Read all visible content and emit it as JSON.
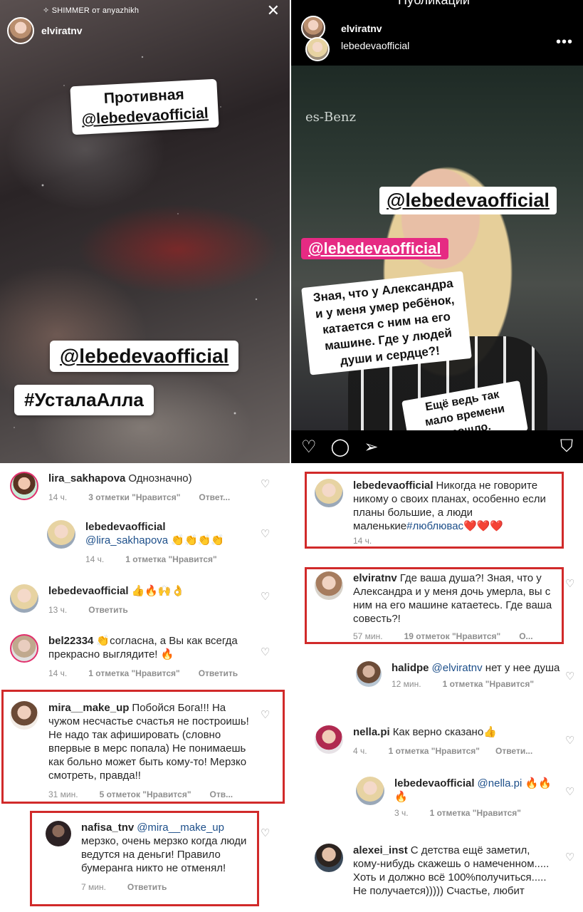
{
  "story_left": {
    "top_text": "SHIMMER от anyazhikh",
    "username": "elviratnv",
    "sticker1_line1": "Противная",
    "sticker1_line2": "@lebedevaofficial",
    "sticker2": "@lebedevaofficial",
    "sticker3": "#УсталаАлла"
  },
  "story_right": {
    "top_label": "Публикации",
    "username1": "elviratnv",
    "username2": "lebedevaofficial",
    "photo_brand": "es-Benz",
    "tag_white": "@lebedevaofficial",
    "tag_pink": "@lebedevaofficial",
    "caption": "Зная, что у Александра и у меня умер ребёнок, катается с ним на его машине. Где у людей души и сердце?!",
    "caption2": "Ещё ведь так мало времени прошло."
  },
  "comments_left": [
    {
      "user": "lira_sakhapova",
      "text": "Однозначно)",
      "time": "14 ч.",
      "likes": "3 отметки \"Нравится\"",
      "reply": "Ответ..."
    },
    {
      "user": "lebedevaofficial",
      "mention": "@lira_sakhapova",
      "text": "👏👏👏👏",
      "time": "14 ч.",
      "likes": "1 отметка \"Нравится\""
    },
    {
      "user": "lebedevaofficial",
      "text": "👍🔥🙌👌",
      "time": "13 ч.",
      "reply": "Ответить"
    },
    {
      "user": "bel22334",
      "text": "👏согласна, а Вы как всегда прекрасно выглядите! 🔥",
      "time": "14 ч.",
      "likes": "1 отметка \"Нравится\"",
      "reply": "Ответить"
    },
    {
      "user": "mira__make_up",
      "text": "Побойся Бога!!! На чужом несчастье счастья не построишь! Не надо так афишировать (словно впервые в мерс попала) Не понимаешь как больно может быть кому-то! Мерзко смотреть, правда!!",
      "time": "31 мин.",
      "likes": "5 отметок \"Нравится\"",
      "reply": "Отв..."
    },
    {
      "user": "nafisa_tnv",
      "mention": "@mira__make_up",
      "text": "мерзко, очень мерзко когда люди ведутся на деньги! Правило бумеранга никто не отменял!",
      "time": "7 мин.",
      "reply": "Ответить"
    }
  ],
  "comments_right": [
    {
      "user": "lebedevaofficial",
      "text": "Никогда не говорите никому о своих планах, особенно если планы большие, а люди маленькие",
      "hashtag": "#люблювас",
      "emoji": "❤️❤️❤️",
      "time": "14 ч."
    },
    {
      "user": "elviratnv",
      "text": "Где ваша душа?! Зная, что у Александра и у меня дочь умерла, вы с ним на его машине катаетесь. Где ваша совесть?!",
      "time": "57 мин.",
      "likes": "19 отметок \"Нравится\"",
      "reply": "О..."
    },
    {
      "user": "halidpe",
      "mention": "@elviratnv",
      "text": "нет у нее душа",
      "time": "12 мин.",
      "likes": "1 отметка \"Нравится\""
    },
    {
      "user": "nella.pi",
      "text": "Как верно сказано👍",
      "time": "4 ч.",
      "likes": "1 отметка \"Нравится\"",
      "reply": "Ответи..."
    },
    {
      "user": "lebedevaofficial",
      "mention": "@nella.pi",
      "text": "🔥🔥🔥",
      "time": "3 ч.",
      "likes": "1 отметка \"Нравится\""
    },
    {
      "user": "alexei_inst",
      "text": "С детства ещё заметил, кому-нибудь скажешь о намеченном..... Хоть и должно всё 100%получиться..... Не получается))))) Счастье, любит"
    }
  ],
  "colors": {
    "highlight_box": "#d12a2a",
    "mention_blue": "#1d4f8a",
    "pink_tag": "#e62a83",
    "meta_gray": "#8e8e8e"
  }
}
